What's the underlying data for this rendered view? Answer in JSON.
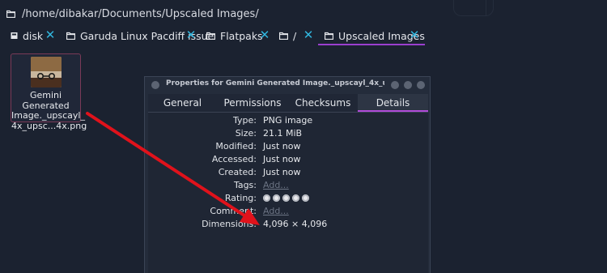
{
  "path": "/home/dibakar/Documents/Upscaled Images/",
  "tabs": [
    {
      "label": "disk",
      "icon": "disk-icon"
    },
    {
      "label": "Garuda Linux Pacdiff issue",
      "icon": "folder-icon"
    },
    {
      "label": "Flatpaks",
      "icon": "folder-icon"
    },
    {
      "label": "/",
      "icon": "folder-icon"
    },
    {
      "label": "Upscaled Images",
      "icon": "folder-icon",
      "active": true
    }
  ],
  "file": {
    "name_line1": "Gemini Generated",
    "name_line2": "Image._upscayl_",
    "name_line3": "4x_upsc...4x.png"
  },
  "dialog": {
    "title": "Properties for Gemini Generated Image._upscayl_4x_up...",
    "tabs": [
      "General",
      "Permissions",
      "Checksums",
      "Details"
    ],
    "active_tab": "Details",
    "rows": {
      "type": {
        "label": "Type:",
        "value": "PNG image"
      },
      "size": {
        "label": "Size:",
        "value": "21.1 MiB"
      },
      "modified": {
        "label": "Modified:",
        "value": "Just now"
      },
      "accessed": {
        "label": "Accessed:",
        "value": "Just now"
      },
      "created": {
        "label": "Created:",
        "value": "Just now"
      },
      "tags": {
        "label": "Tags:",
        "value": "Add..."
      },
      "rating": {
        "label": "Rating:",
        "stars": 5
      },
      "comment": {
        "label": "Comment:",
        "value": "Add..."
      },
      "dimensions": {
        "label": "Dimensions:",
        "value": "4,096 × 4,096"
      }
    }
  },
  "colors": {
    "accent_purple": "#9b3fcf",
    "close_cyan": "#31b6de",
    "arrow_red": "#e0121b"
  }
}
